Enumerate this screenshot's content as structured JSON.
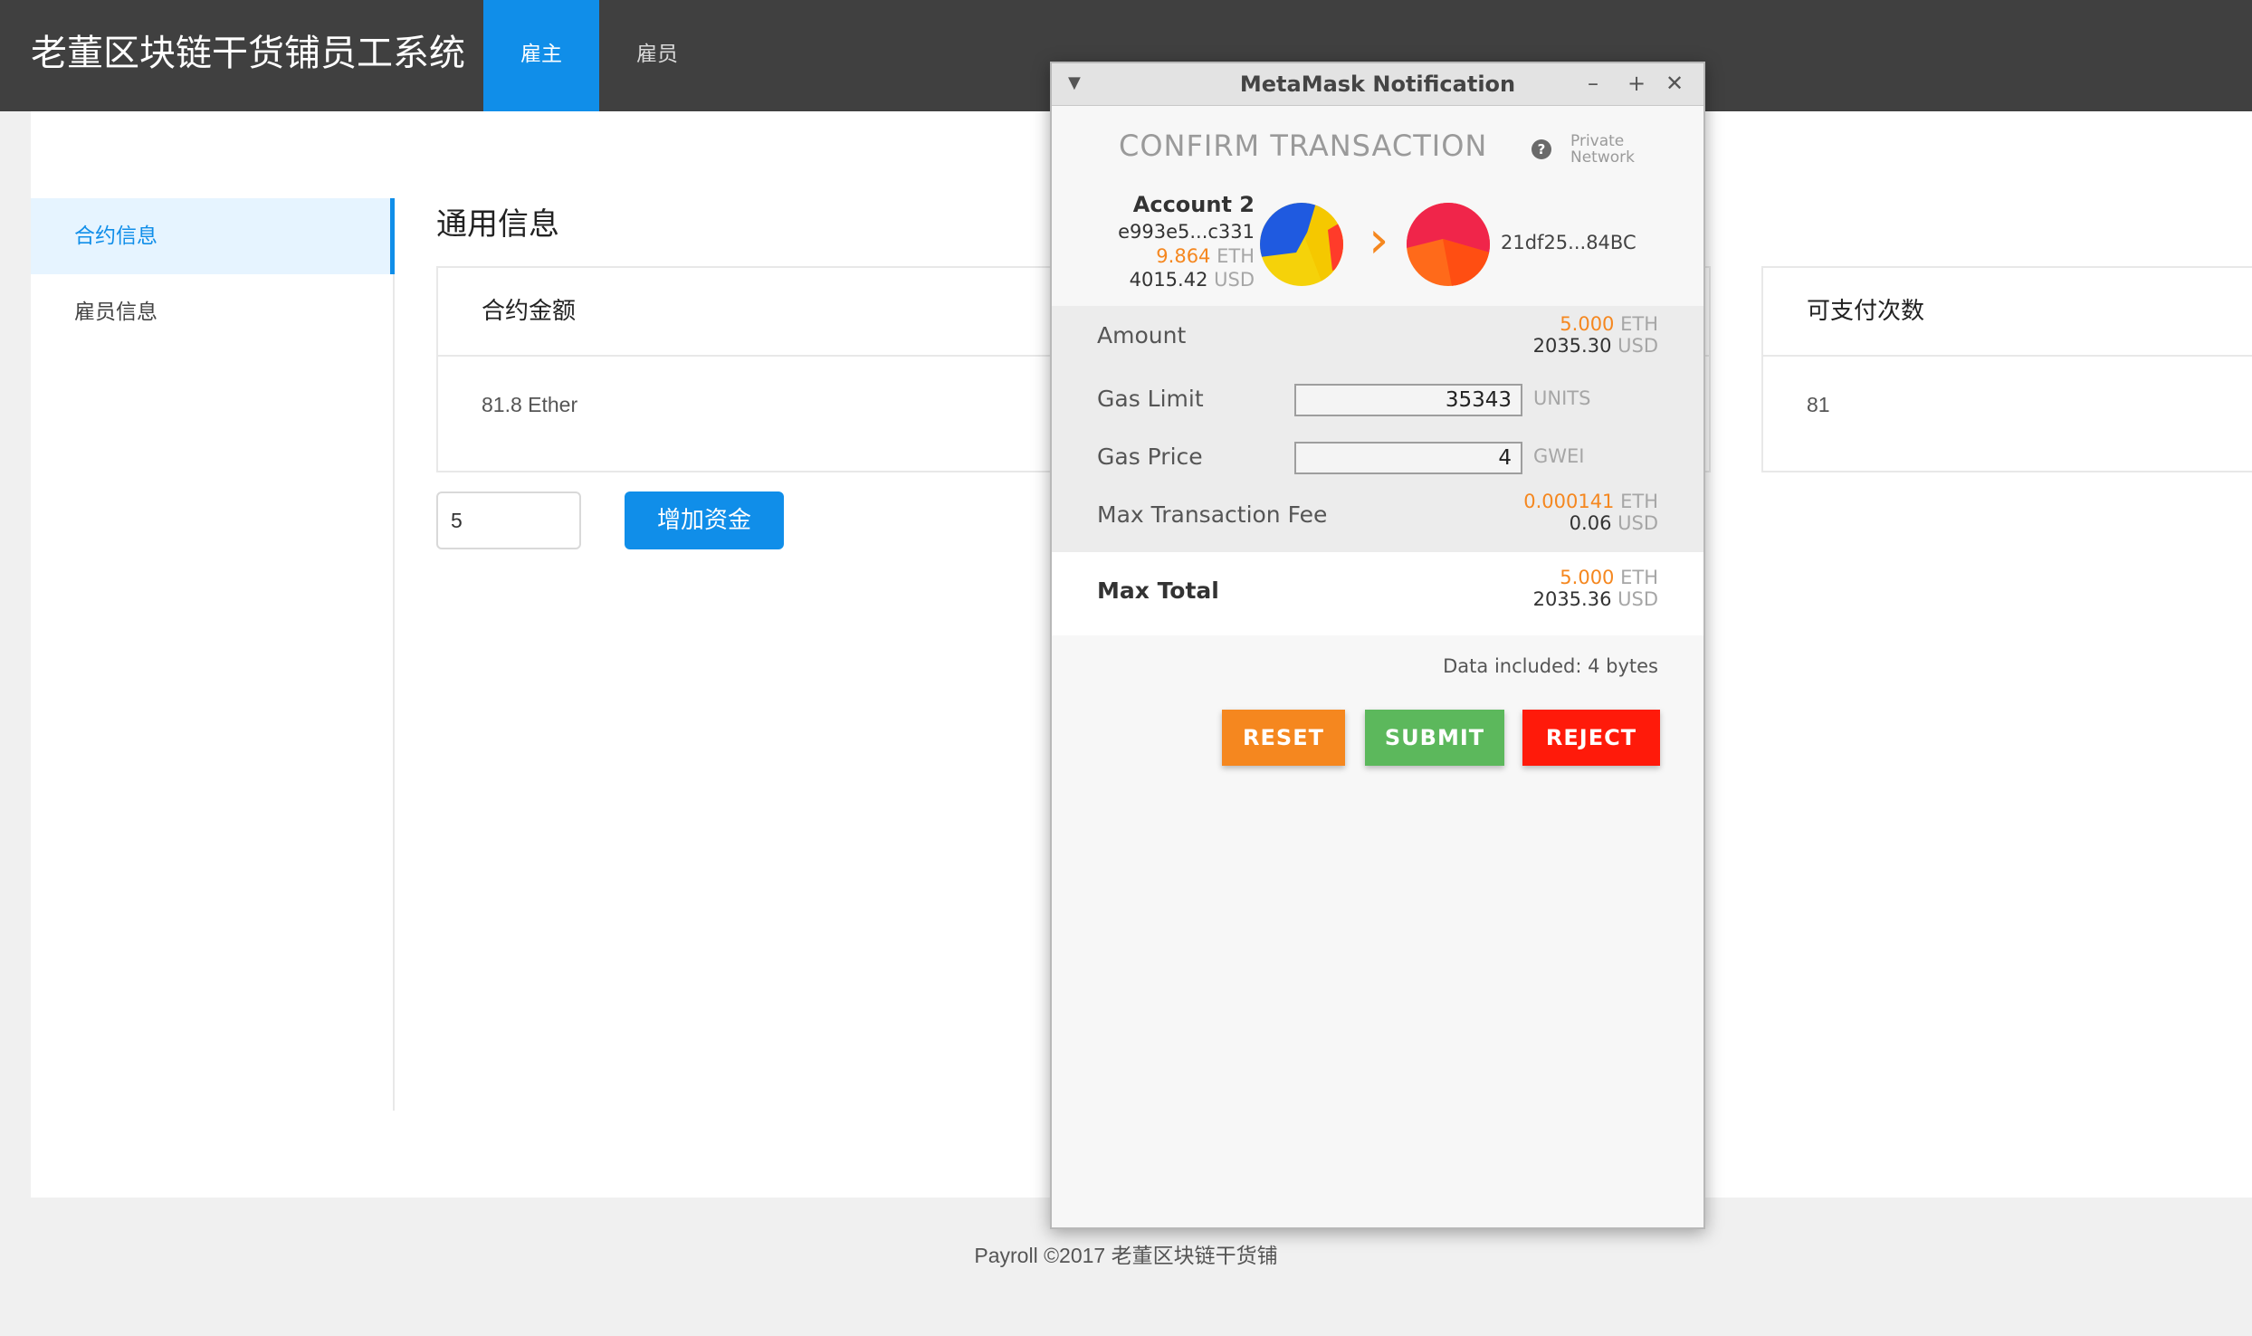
{
  "header": {
    "title": "老董区块链干货铺员工系统",
    "tabs": [
      {
        "label": "雇主",
        "active": true
      },
      {
        "label": "雇员",
        "active": false
      }
    ]
  },
  "sidebar": {
    "items": [
      {
        "label": "合约信息",
        "active": true
      },
      {
        "label": "雇员信息",
        "active": false
      }
    ]
  },
  "main": {
    "section_title": "通用信息",
    "cards": [
      {
        "title": "合约金额",
        "value": "81.8 Ether"
      },
      {
        "title": "可支付次数",
        "value": "81"
      }
    ],
    "amount_input_value": "5",
    "add_fund_label": "增加资金"
  },
  "footer": {
    "text": "Payroll ©2017 老董区块链干货铺"
  },
  "metamask": {
    "window_title": "MetaMask Notification",
    "heading": "CONFIRM TRANSACTION",
    "network_line1": "Private",
    "network_line2": "Network",
    "account": {
      "name": "Account 2",
      "address": "e993e5...c331",
      "eth_balance": "9.864",
      "eth_unit": "ETH",
      "usd_balance": "4015.42",
      "usd_unit": "USD"
    },
    "recipient": "21df25...84BC",
    "amount": {
      "label": "Amount",
      "eth": "5.000",
      "eth_unit": "ETH",
      "usd": "2035.30",
      "usd_unit": "USD"
    },
    "gas_limit": {
      "label": "Gas Limit",
      "value": "35343",
      "unit": "UNITS"
    },
    "gas_price": {
      "label": "Gas Price",
      "value": "4",
      "unit": "GWEI"
    },
    "max_fee": {
      "label": "Max Transaction Fee",
      "eth": "0.000141",
      "eth_unit": "ETH",
      "usd": "0.06",
      "usd_unit": "USD"
    },
    "max_total": {
      "label": "Max Total",
      "eth": "5.000",
      "eth_unit": "ETH",
      "usd": "2035.36",
      "usd_unit": "USD"
    },
    "data_included": "Data included: 4 bytes",
    "buttons": {
      "reset": "RESET",
      "submit": "SUBMIT",
      "reject": "REJECT"
    },
    "colors": {
      "reset": "#f5871f",
      "submit": "#5cb85c",
      "reject": "#ff1a0a",
      "accent": "#f5871f"
    }
  }
}
